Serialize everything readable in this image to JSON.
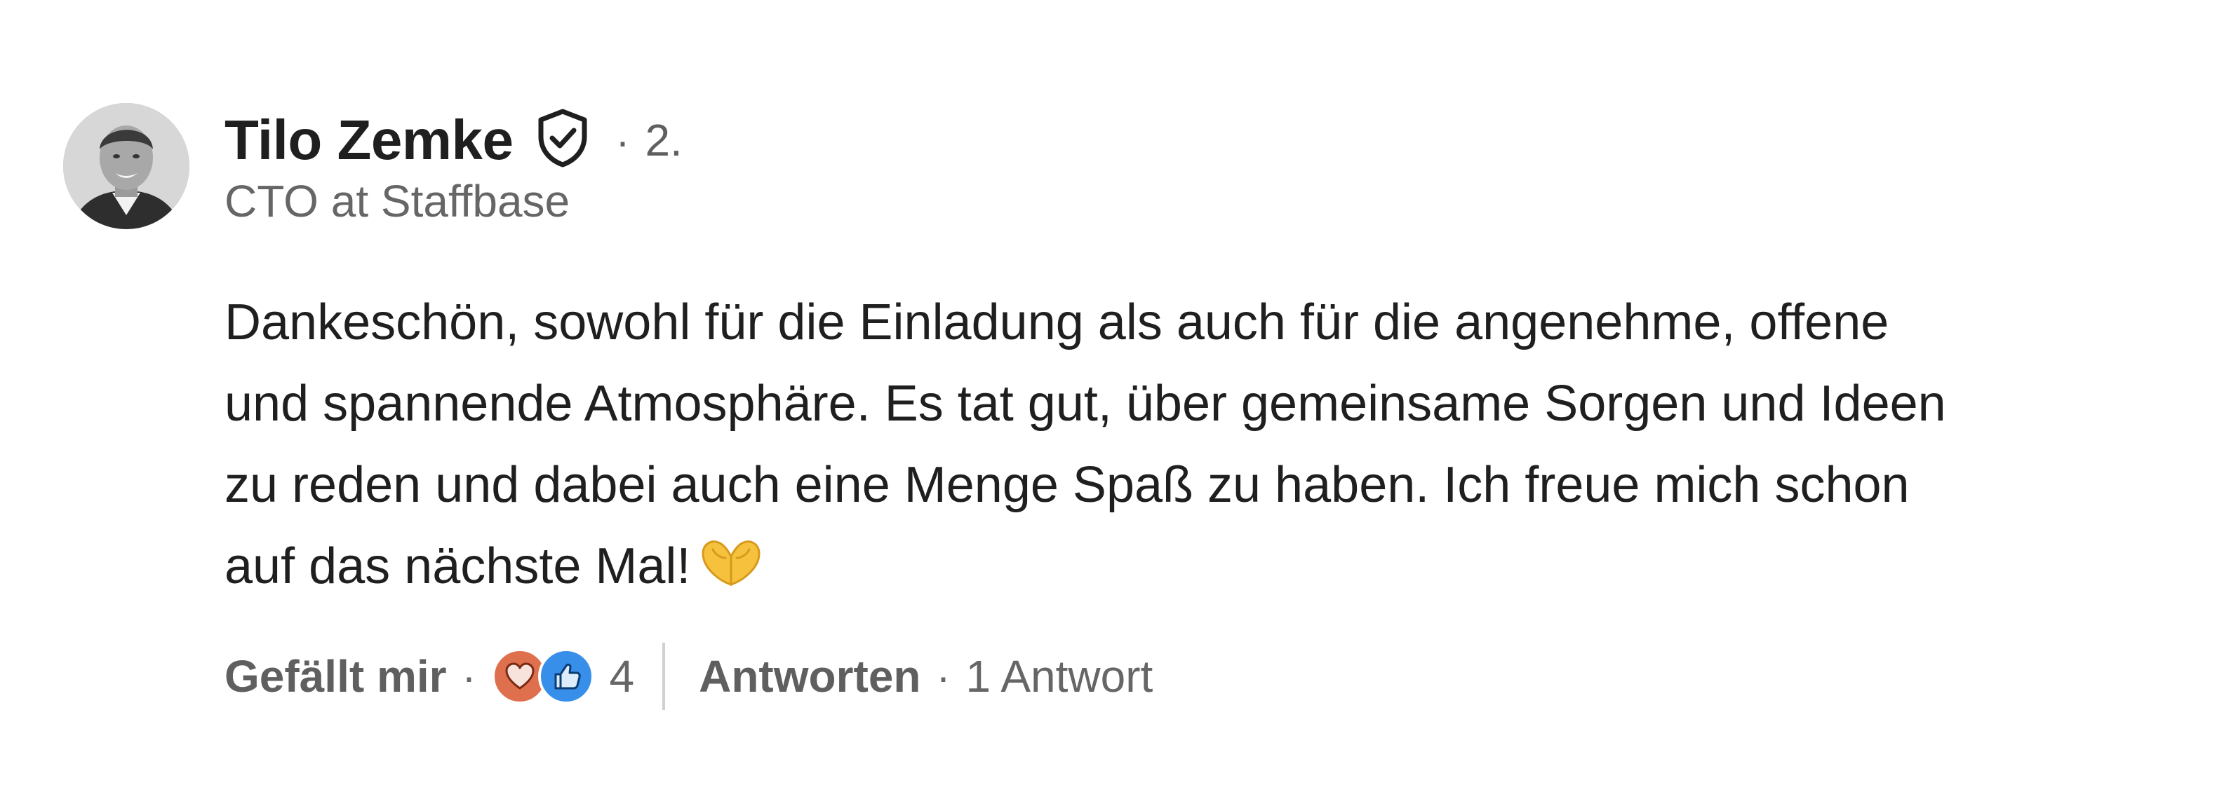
{
  "comment": {
    "author": {
      "name": "Tilo Zemke",
      "degree_separator": "·",
      "degree": "2.",
      "headline": "CTO at Staffbase",
      "avatar_icon": "profile-photo",
      "verified_icon": "shield-check-icon"
    },
    "body_lines": [
      "Dankeschön, sowohl für die Einladung als auch für die angenehme, offene",
      "und spannende Atmosphäre. Es tat gut, über gemeinsame Sorgen und Ideen",
      "zu reden und dabei auch eine Menge Spaß zu haben. Ich freue mich schon",
      "auf das nächste Mal!"
    ],
    "body_emoji": "heart-hands-emoji",
    "actions": {
      "like_label": "Gefällt mir",
      "separator": "·",
      "reactions": [
        "love",
        "like"
      ],
      "reaction_count": "4",
      "reply_label": "Antworten",
      "reply_count": "1 Antwort"
    }
  },
  "colors": {
    "love_reaction": "#df704d",
    "like_reaction": "#378fe9",
    "text_primary": "#1f1f1f",
    "text_secondary": "#666666"
  }
}
